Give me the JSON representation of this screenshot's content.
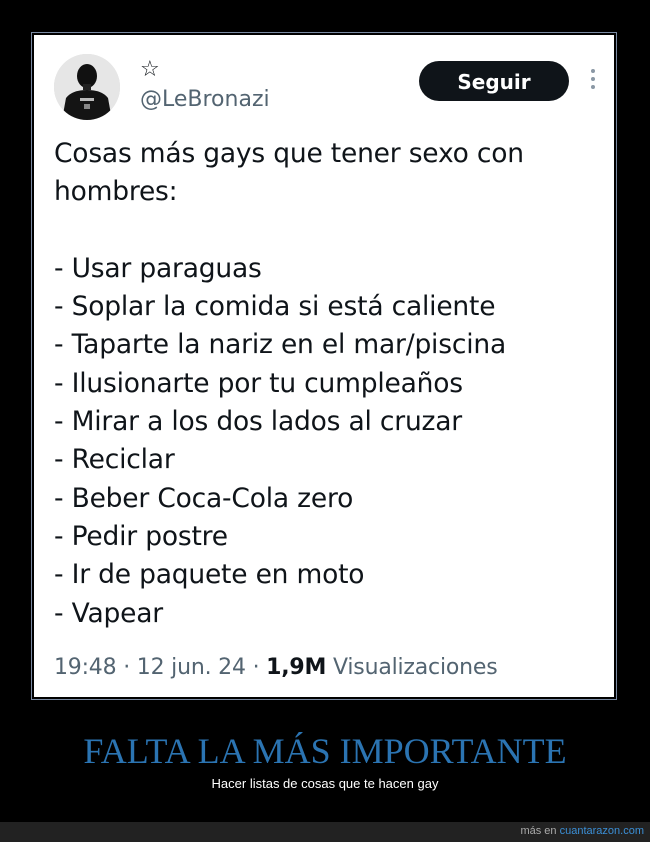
{
  "tweet": {
    "display_name": "☆",
    "handle": "@LeBronazi",
    "follow_label": "Seguir",
    "lines": [
      "Cosas más gays que tener sexo con",
      "hombres:",
      "",
      "- Usar paraguas",
      "- Soplar la comida si está caliente",
      "- Taparte la nariz en el mar/piscina",
      "- Ilusionarte por tu cumpleaños",
      "- Mirar a los dos lados al cruzar",
      "- Reciclar",
      "- Beber Coca-Cola zero",
      "- Pedir postre",
      "- Ir de paquete en moto",
      "- Vapear"
    ],
    "time": "19:48",
    "date": "12 jun. 24",
    "views_count": "1,9M",
    "views_label": "Visualizaciones"
  },
  "caption": {
    "title": "FALTA LA MÁS IMPORTANTE",
    "subtitle": "Hacer listas de cosas que te hacen gay"
  },
  "footer": {
    "prefix": "más en",
    "site": "cuantarazon.com"
  },
  "colors": {
    "background": "#000000",
    "caption_title": "#2b74b2",
    "follow_button": "#0f1419",
    "handle_gray": "#536471",
    "link_blue": "#3b8fd6"
  }
}
